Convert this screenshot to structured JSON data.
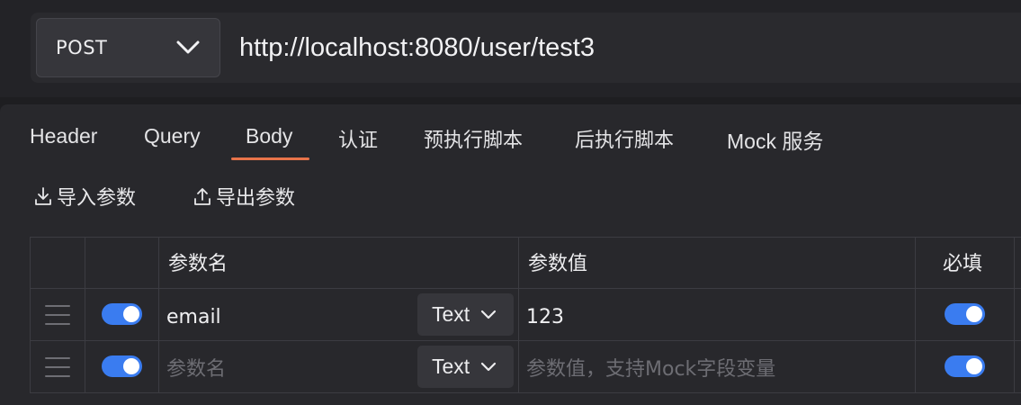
{
  "request": {
    "method": "POST",
    "url": "http://localhost:8080/user/test3"
  },
  "tabs": [
    {
      "label": "Header",
      "active": false
    },
    {
      "label": "Query",
      "active": false
    },
    {
      "label": "Body",
      "active": true
    },
    {
      "label": "认证",
      "active": false
    },
    {
      "label": "预执行脚本",
      "active": false
    },
    {
      "label": "后执行脚本",
      "active": false
    },
    {
      "label": "Mock 服务",
      "active": false
    }
  ],
  "actions": {
    "import_label": "导入参数",
    "export_label": "导出参数"
  },
  "table": {
    "headers": {
      "name": "参数名",
      "value": "参数值",
      "required": "必填"
    },
    "rows": [
      {
        "enabled": true,
        "name": "email",
        "type": "Text",
        "value": "123",
        "required": true
      },
      {
        "enabled": true,
        "name": "",
        "type": "Text",
        "value": "",
        "required": true
      }
    ],
    "placeholders": {
      "name": "参数名",
      "value": "参数值，支持Mock字段变量"
    }
  },
  "colors": {
    "accent": "#e8734a",
    "toggle_on": "#3a7cf0"
  }
}
